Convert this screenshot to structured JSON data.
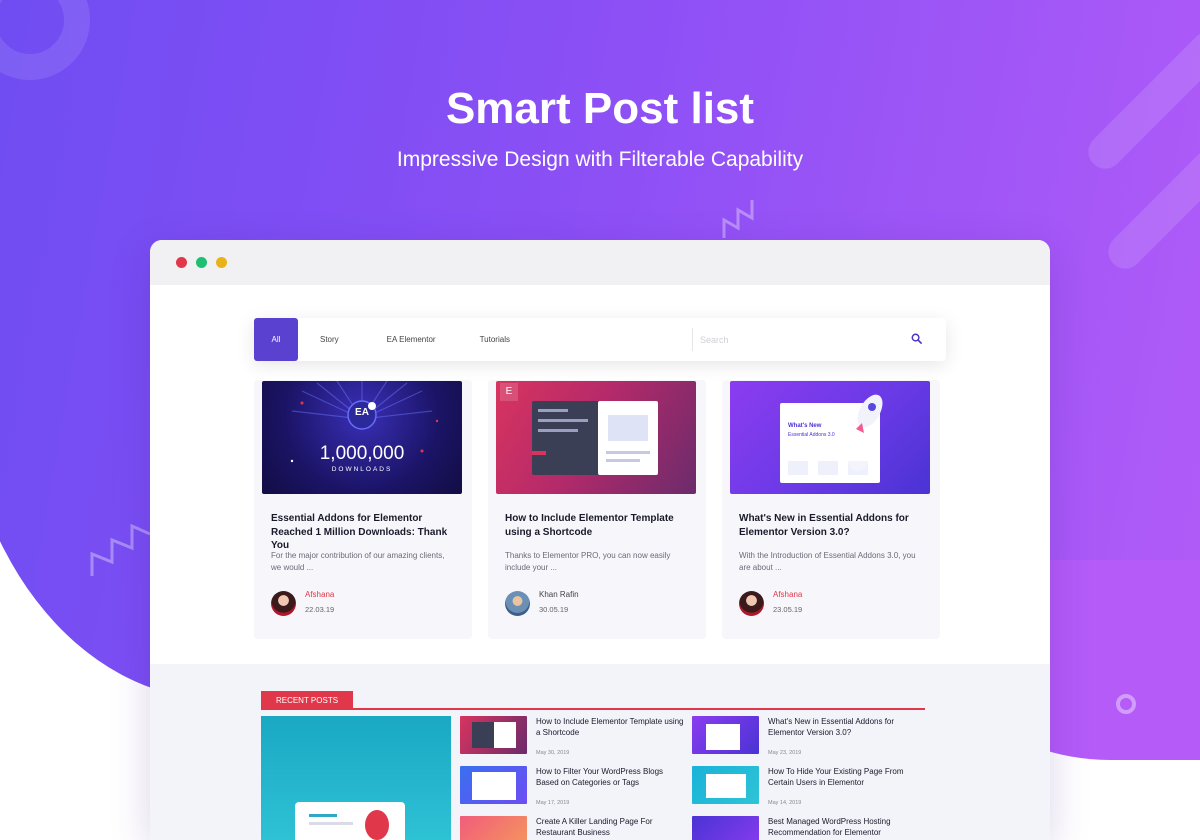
{
  "hero": {
    "title": "Smart Post list",
    "subtitle": "Impressive Design with Filterable Capability"
  },
  "colors": {
    "accent": "#5a41cf",
    "author_red": "#e0384a",
    "author_gray": "#444444",
    "recent_red": "#e0384a"
  },
  "filter": {
    "tabs": [
      {
        "label": "All",
        "active": true
      },
      {
        "label": "Story",
        "active": false
      },
      {
        "label": "EA Elementor",
        "active": false
      },
      {
        "label": "Tutorials",
        "active": false
      }
    ],
    "search_placeholder": "Search",
    "search_icon": "search-icon"
  },
  "posts": [
    {
      "image_text": {
        "big": "1,000,000",
        "small": "DOWNLOADS",
        "logo": "EA"
      },
      "title": "Essential Addons for Elementor Reached 1 Million Downloads: Thank You",
      "excerpt": "For the major contribution of our amazing clients, we would ...",
      "author": "Afshana",
      "date": "22.03.19"
    },
    {
      "image_text": {
        "logo": "E"
      },
      "title": "How to Include Elementor Template using a Shortcode",
      "excerpt": "Thanks to Elementor PRO, you can now easily include your ...",
      "author": "Khan Rafin",
      "date": "30.05.19"
    },
    {
      "image_text": {
        "heading": "What's New",
        "sub": "Essential Addons 3.0"
      },
      "title": "What's New in Essential Addons for Elementor Version 3.0?",
      "excerpt": "With the Introduction of Essential Addons 3.0, you are about ...",
      "author": "Afshana",
      "date": "23.05.19"
    }
  ],
  "recent": {
    "label": "RECENT POSTS",
    "items": [
      {
        "title": "How to Include Elementor Template using a Shortcode",
        "date": "May 30, 2019"
      },
      {
        "title": "What's New in Essential Addons for Elementor Version 3.0?",
        "date": "May 23, 2019"
      },
      {
        "title": "How to Filter Your WordPress Blogs Based on Categories or Tags",
        "date": "May 17, 2019"
      },
      {
        "title": "How To Hide Your Existing Page From Certain Users in Elementor",
        "date": "May 14, 2019"
      },
      {
        "title": "Create A Killer Landing Page For Restaurant Business",
        "date": ""
      },
      {
        "title": "Best Managed WordPress Hosting Recommendation for Elementor",
        "date": ""
      }
    ]
  }
}
